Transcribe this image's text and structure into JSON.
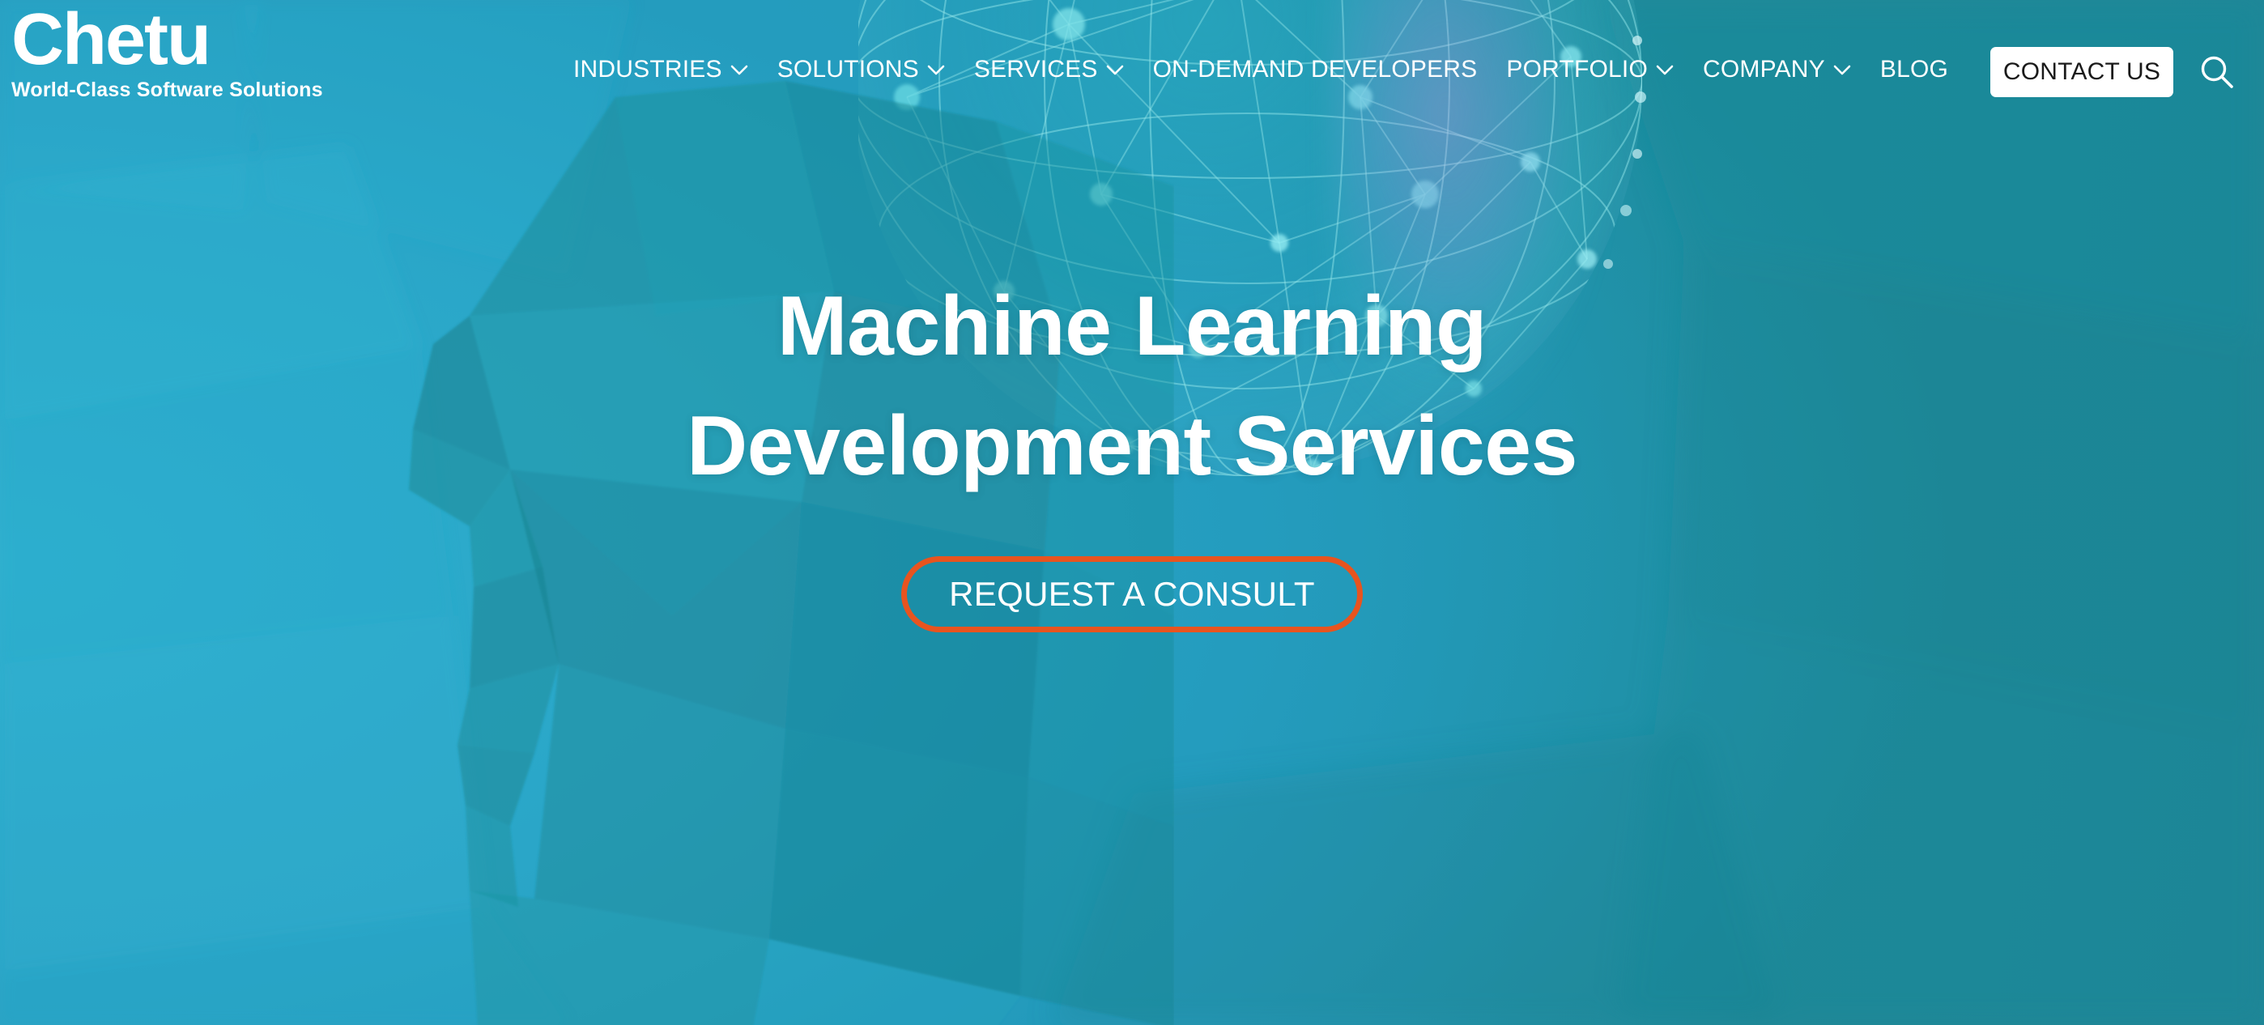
{
  "theme": {
    "bg_left": "#2aa8c9",
    "bg_right": "#1d8a99",
    "accent_orange": "#e8541f",
    "text_on_dark": "#ffffff",
    "button_bg": "#ffffff",
    "button_text": "#1a1a1a",
    "sphere_line": "#8fe3e8",
    "sphere_glow": "#b696dc"
  },
  "header": {
    "logo": {
      "word": "Chetu",
      "tagline": "World-Class Software Solutions"
    },
    "nav": [
      {
        "label": "INDUSTRIES",
        "has_dropdown": true
      },
      {
        "label": "SOLUTIONS",
        "has_dropdown": true
      },
      {
        "label": "SERVICES",
        "has_dropdown": true
      },
      {
        "label": "ON-DEMAND DEVELOPERS",
        "has_dropdown": false
      },
      {
        "label": "PORTFOLIO",
        "has_dropdown": true
      },
      {
        "label": "COMPANY",
        "has_dropdown": true
      },
      {
        "label": "BLOG",
        "has_dropdown": false
      }
    ],
    "contact_button": "CONTACT US",
    "search_icon": "search-icon"
  },
  "hero": {
    "title_line1": "Machine Learning",
    "title_line2": "Development Services",
    "cta_label": "REQUEST A CONSULT",
    "illustration": {
      "head": "low-poly-human-head-profile",
      "network": "network-sphere-nodes-and-edges"
    }
  }
}
